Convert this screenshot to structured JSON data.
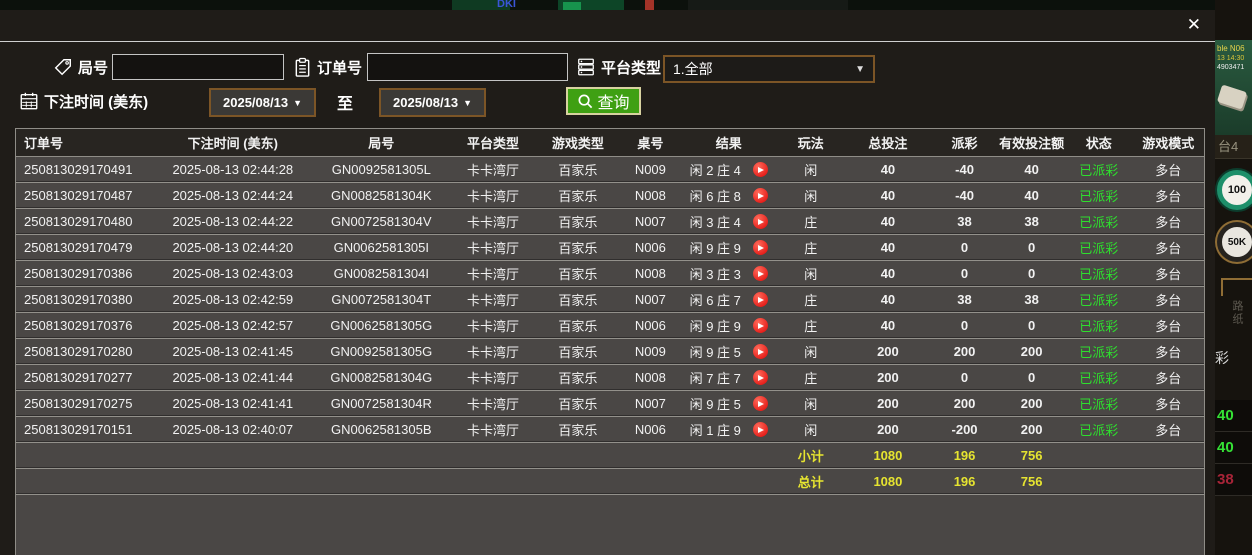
{
  "window": {
    "close_icon": "✕"
  },
  "filters": {
    "round_label": "局号",
    "round_value": "",
    "order_label": "订单号",
    "order_value": "",
    "platform_label": "平台类型",
    "platform_value": "1.全部",
    "bet_time_label": "下注时间 (美东)",
    "date_from": "2025/08/13",
    "date_to": "2025/08/13",
    "to_label": "至",
    "caret": "▼",
    "query_label": "查询"
  },
  "table": {
    "headers": [
      "订单号",
      "下注时间 (美东)",
      "局号",
      "平台类型",
      "游戏类型",
      "桌号",
      "结果",
      "玩法",
      "总投注",
      "派彩",
      "有效投注额",
      "状态",
      "游戏模式"
    ],
    "rows": [
      {
        "order": "250813029170491",
        "time": "2025-08-13 02:44:28",
        "round": "GN0092581305L",
        "platform": "卡卡湾厅",
        "game": "百家乐",
        "table": "N009",
        "result": "闲 2 庄 4",
        "bet": "闲",
        "total_bet": "40",
        "payout": "-40",
        "payout_tone": "loss",
        "valid_bet": "40",
        "status": "已派彩",
        "mode": "多台"
      },
      {
        "order": "250813029170487",
        "time": "2025-08-13 02:44:24",
        "round": "GN0082581304K",
        "platform": "卡卡湾厅",
        "game": "百家乐",
        "table": "N008",
        "result": "闲 6 庄 8",
        "bet": "闲",
        "total_bet": "40",
        "payout": "-40",
        "payout_tone": "loss",
        "valid_bet": "40",
        "status": "已派彩",
        "mode": "多台"
      },
      {
        "order": "250813029170480",
        "time": "2025-08-13 02:44:22",
        "round": "GN0072581304V",
        "platform": "卡卡湾厅",
        "game": "百家乐",
        "table": "N007",
        "result": "闲 3 庄 4",
        "bet": "庄",
        "total_bet": "40",
        "payout": "38",
        "payout_tone": "win",
        "valid_bet": "38",
        "status": "已派彩",
        "mode": "多台"
      },
      {
        "order": "250813029170479",
        "time": "2025-08-13 02:44:20",
        "round": "GN0062581305I",
        "platform": "卡卡湾厅",
        "game": "百家乐",
        "table": "N006",
        "result": "闲 9 庄 9",
        "bet": "庄",
        "total_bet": "40",
        "payout": "0",
        "payout_tone": "zero",
        "valid_bet": "0",
        "status": "已派彩",
        "mode": "多台"
      },
      {
        "order": "250813029170386",
        "time": "2025-08-13 02:43:03",
        "round": "GN0082581304I",
        "platform": "卡卡湾厅",
        "game": "百家乐",
        "table": "N008",
        "result": "闲 3 庄 3",
        "bet": "闲",
        "total_bet": "40",
        "payout": "0",
        "payout_tone": "zero",
        "valid_bet": "0",
        "status": "已派彩",
        "mode": "多台"
      },
      {
        "order": "250813029170380",
        "time": "2025-08-13 02:42:59",
        "round": "GN0072581304T",
        "platform": "卡卡湾厅",
        "game": "百家乐",
        "table": "N007",
        "result": "闲 6 庄 7",
        "bet": "庄",
        "total_bet": "40",
        "payout": "38",
        "payout_tone": "win",
        "valid_bet": "38",
        "status": "已派彩",
        "mode": "多台"
      },
      {
        "order": "250813029170376",
        "time": "2025-08-13 02:42:57",
        "round": "GN0062581305G",
        "platform": "卡卡湾厅",
        "game": "百家乐",
        "table": "N006",
        "result": "闲 9 庄 9",
        "bet": "庄",
        "total_bet": "40",
        "payout": "0",
        "payout_tone": "zero",
        "valid_bet": "0",
        "status": "已派彩",
        "mode": "多台"
      },
      {
        "order": "250813029170280",
        "time": "2025-08-13 02:41:45",
        "round": "GN0092581305G",
        "platform": "卡卡湾厅",
        "game": "百家乐",
        "table": "N009",
        "result": "闲 9 庄 5",
        "bet": "闲",
        "total_bet": "200",
        "payout": "200",
        "payout_tone": "win",
        "valid_bet": "200",
        "status": "已派彩",
        "mode": "多台"
      },
      {
        "order": "250813029170277",
        "time": "2025-08-13 02:41:44",
        "round": "GN0082581304G",
        "platform": "卡卡湾厅",
        "game": "百家乐",
        "table": "N008",
        "result": "闲 7 庄 7",
        "bet": "庄",
        "total_bet": "200",
        "payout": "0",
        "payout_tone": "zero",
        "valid_bet": "0",
        "status": "已派彩",
        "mode": "多台"
      },
      {
        "order": "250813029170275",
        "time": "2025-08-13 02:41:41",
        "round": "GN0072581304R",
        "platform": "卡卡湾厅",
        "game": "百家乐",
        "table": "N007",
        "result": "闲 9 庄 5",
        "bet": "闲",
        "total_bet": "200",
        "payout": "200",
        "payout_tone": "win",
        "valid_bet": "200",
        "status": "已派彩",
        "mode": "多台"
      },
      {
        "order": "250813029170151",
        "time": "2025-08-13 02:40:07",
        "round": "GN0062581305B",
        "platform": "卡卡湾厅",
        "game": "百家乐",
        "table": "N006",
        "result": "闲 1 庄 9",
        "bet": "闲",
        "total_bet": "200",
        "payout": "-200",
        "payout_tone": "loss",
        "valid_bet": "200",
        "status": "已派彩",
        "mode": "多台"
      }
    ],
    "subtotal": {
      "label": "小计",
      "total_bet": "1080",
      "payout": "196",
      "valid_bet": "756"
    },
    "grand_total": {
      "label": "总计",
      "total_bet": "1080",
      "payout": "196",
      "valid_bet": "756"
    }
  },
  "colors": {
    "header_gold": "#d9ba6b",
    "status_green": "#2ede2e",
    "payout_loss_green": "#35e235",
    "payout_win_red": "#a82438",
    "totals_yellow": "#e6e430",
    "query_green": "#3fa013",
    "date_border_brown": "#7c5526"
  },
  "background": {
    "top_fragment_text": "DKI",
    "right": {
      "game_text_line1": "ble N06",
      "game_text_line2": "13 14:30",
      "game_text_line3": "4903471",
      "table_tab": "台4",
      "chip1": "100",
      "chip2": "50K",
      "side_label": "路纸",
      "glyph": "彩",
      "values": [
        {
          "text": "40",
          "tone": "loss"
        },
        {
          "text": "40",
          "tone": "loss"
        },
        {
          "text": "38",
          "tone": "win"
        }
      ]
    }
  }
}
